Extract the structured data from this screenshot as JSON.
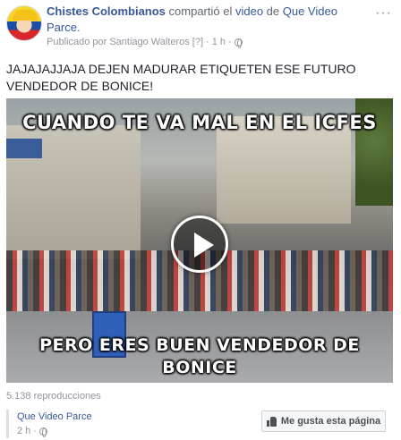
{
  "post": {
    "author": "Chistes Colombianos",
    "action_text": " compartió el ",
    "object_link": "video",
    "connector": " de ",
    "source_page": "Que Video Parce",
    "period": ".",
    "published_by": "Publicado por Santiago Walteros",
    "published_marker": "[?]",
    "separator": "·",
    "time": "1 h",
    "more_label": "···",
    "text": "JAJAJAJJAJA DEJEN MADURAR ETIQUETEN ESE FUTURO VENDEDOR DE BONICE!"
  },
  "video": {
    "caption_top": "CUANDO TE VA MAL EN EL ICFES",
    "caption_bottom": "PERO ERES BUEN VENDEDOR DE BONICE",
    "views": "5.138 reproducciones"
  },
  "footer": {
    "page_name": "Que Video Parce",
    "time": "2 h",
    "separator": "·",
    "like_button_label": "Me gusta esta página"
  },
  "icons": {
    "privacy": "globe-icon",
    "play": "play-icon",
    "like": "thumbs-up-icon",
    "menu": "more-icon"
  },
  "colors": {
    "link": "#365899",
    "meta": "#90949c",
    "text": "#1d2129"
  }
}
